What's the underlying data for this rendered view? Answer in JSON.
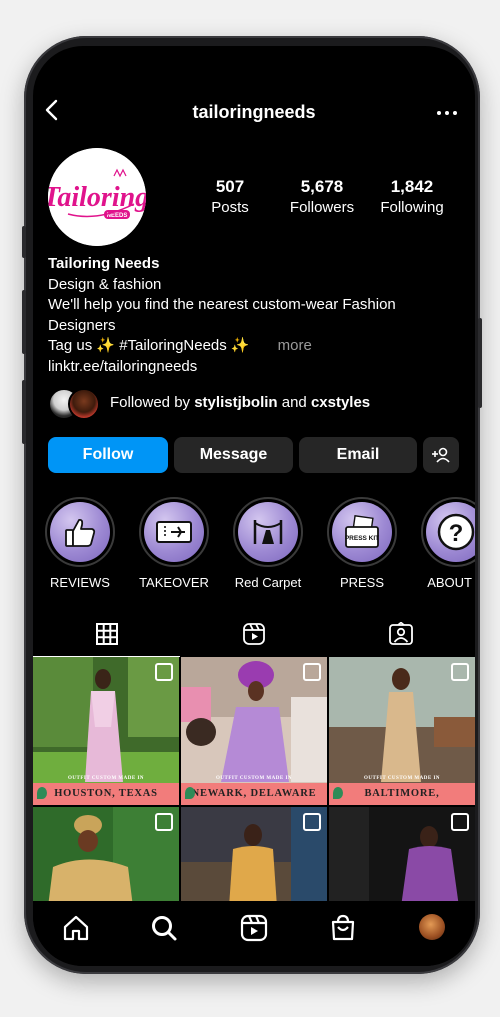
{
  "header": {
    "username": "tailoringneeds"
  },
  "avatar_logo": {
    "text": "Tailoring",
    "sub": "NEEDS"
  },
  "stats": [
    {
      "value": "507",
      "label": "Posts"
    },
    {
      "value": "5,678",
      "label": "Followers"
    },
    {
      "value": "1,842",
      "label": "Following"
    }
  ],
  "bio": {
    "name": "Tailoring Needs",
    "category": "Design & fashion",
    "line1": "We'll help you find the nearest custom-wear Fashion",
    "line2": "Designers",
    "line3": "Tag us ✨ #TailoringNeeds ✨",
    "more": "more",
    "link": "linktr.ee/tailoringneeds"
  },
  "followed_by": {
    "prefix": "Followed by ",
    "user1": "stylistjbolin",
    "and": " and ",
    "user2": "cxstyles"
  },
  "buttons": {
    "follow": "Follow",
    "message": "Message",
    "email": "Email"
  },
  "highlights": [
    {
      "label": "REVIEWS",
      "icon": "thumbs-up-icon"
    },
    {
      "label": "TAKEOVER",
      "icon": "ticket-icon"
    },
    {
      "label": "Red Carpet",
      "icon": "red-carpet-icon"
    },
    {
      "label": "PRESS",
      "icon": "press-kit-icon",
      "inner_text": "PRESS KIT"
    },
    {
      "label": "ABOUT U",
      "icon": "question-icon",
      "inner_text": "?"
    }
  ],
  "tabs": [
    {
      "name": "grid",
      "icon": "grid-icon",
      "active": true
    },
    {
      "name": "reels",
      "icon": "reels-icon",
      "active": false
    },
    {
      "name": "tagged",
      "icon": "tagged-icon",
      "active": false
    }
  ],
  "posts": [
    {
      "location": "HOUSTON, TEXAS",
      "caption": "OUTFIT CUSTOM MADE IN"
    },
    {
      "location": "NEWARK, DELAWARE",
      "caption": "OUTFIT CUSTOM MADE IN"
    },
    {
      "location": "BALTIMORE, MARYLAND",
      "caption": "OUTFIT CUSTOM MADE IN"
    },
    {
      "location": "",
      "caption": ""
    },
    {
      "location": "",
      "caption": ""
    },
    {
      "location": "",
      "caption": ""
    }
  ],
  "bottom_nav": [
    "home-icon",
    "search-icon",
    "reels-icon",
    "shop-icon",
    "profile-avatar"
  ],
  "colors": {
    "follow_blue": "#0095f6",
    "banner_coral": "#f27c7b",
    "logo_magenta": "#e0138c",
    "highlight_purple": "#9d89d3"
  }
}
